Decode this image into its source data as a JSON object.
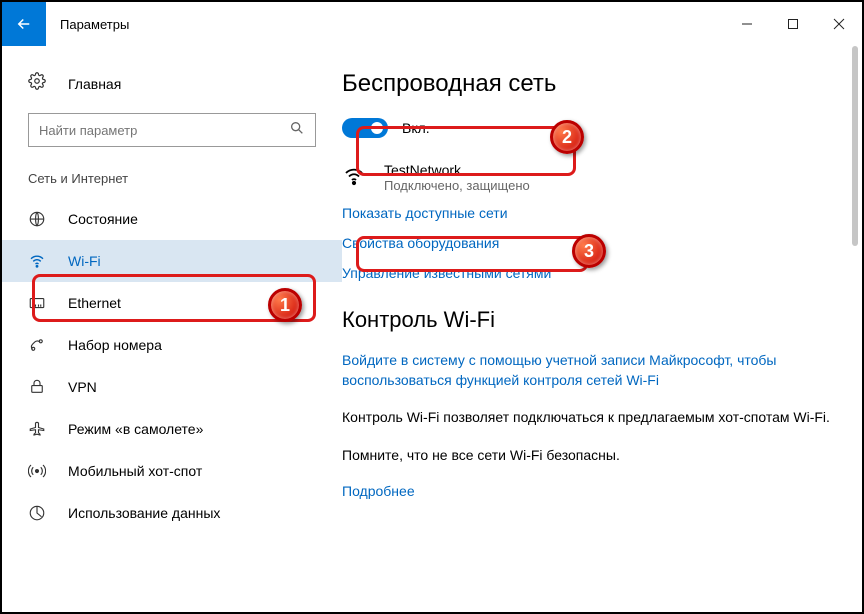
{
  "titlebar": {
    "title": "Параметры"
  },
  "sidebar": {
    "home": "Главная",
    "search_placeholder": "Найти параметр",
    "section": "Сеть и Интернет",
    "items": [
      {
        "label": "Состояние"
      },
      {
        "label": "Wi-Fi"
      },
      {
        "label": "Ethernet"
      },
      {
        "label": "Набор номера"
      },
      {
        "label": "VPN"
      },
      {
        "label": "Режим «в самолете»"
      },
      {
        "label": "Мобильный хот-спот"
      },
      {
        "label": "Использование данных"
      }
    ]
  },
  "main": {
    "h1": "Беспроводная сеть",
    "toggle_label": "Вкл.",
    "network": {
      "name": "TestNetwork",
      "status": "Подключено, защищено"
    },
    "link_show": "Показать доступные сети",
    "link_props": "Свойства оборудования",
    "link_manage": "Управление известными сетями",
    "h2": "Контроль Wi-Fi",
    "signin": "Войдите в систему с помощью учетной записи Майкрософт, чтобы воспользоваться функцией контроля сетей Wi-Fi",
    "desc": "Контроль Wi-Fi позволяет подключаться к предлагаемым хот-спотам Wi-Fi.",
    "warn": "Помните, что не все сети Wi-Fi безопасны.",
    "more": "Подробнее"
  },
  "annotations": {
    "b1": "1",
    "b2": "2",
    "b3": "3"
  }
}
